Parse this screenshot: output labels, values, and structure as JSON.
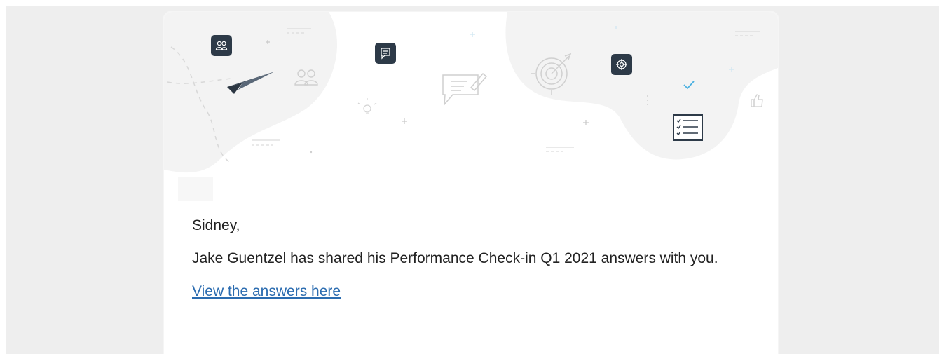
{
  "email": {
    "greeting": "Sidney,",
    "message": "Jake Guentzel has shared his Performance Check-in Q1 2021 answers with you.",
    "link_text": "View the answers here"
  },
  "colors": {
    "page_background": "#eeeeee",
    "card_background": "#ffffff",
    "blob": "#f3f3f3",
    "icon_tile": "#2d3a48",
    "link": "#2b6cb0",
    "check_accent": "#4ab0e0"
  },
  "hero_icons": [
    "people-icon",
    "paper-plane-icon",
    "chat-icon",
    "lightbulb-icon",
    "target-icon",
    "crosshair-icon",
    "checklist-icon",
    "thumbs-up-icon",
    "checkmark-icon"
  ]
}
